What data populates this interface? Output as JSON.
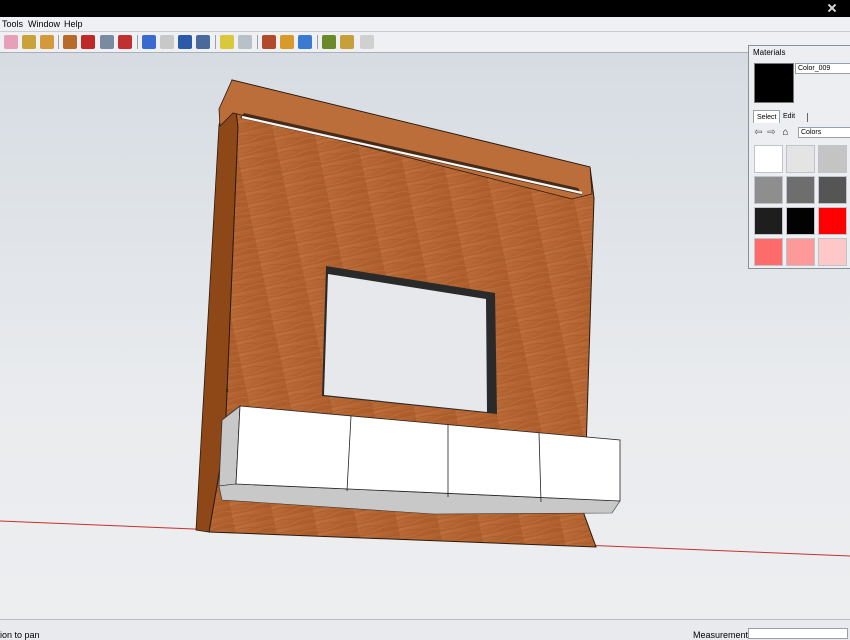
{
  "menu": [
    "Tools",
    "Window",
    "Help"
  ],
  "toolbar": {
    "icons": [
      {
        "name": "eraser-icon",
        "color": "#e8a0b8"
      },
      {
        "name": "tape-measure-icon",
        "color": "#c9a23a"
      },
      {
        "name": "paint-bucket-icon",
        "color": "#d49a3a"
      },
      {
        "name": "push-pull-icon",
        "color": "#b86a2a"
      },
      {
        "name": "move-icon",
        "color": "#c02828"
      },
      {
        "name": "rotate-icon",
        "color": "#7a8aa0"
      },
      {
        "name": "follow-me-icon",
        "color": "#c03030"
      },
      {
        "name": "orbit-icon",
        "color": "#3a6ad0"
      },
      {
        "name": "pan-icon",
        "color": "#c8c8c8"
      },
      {
        "name": "zoom-icon",
        "color": "#2a5aa8"
      },
      {
        "name": "zoom-extents-icon",
        "color": "#4a6a9a"
      },
      {
        "name": "add-location-icon",
        "color": "#d8c83a"
      },
      {
        "name": "toggle-terrain-icon",
        "color": "#b8c0c8"
      },
      {
        "name": "get-models-icon",
        "color": "#b04a2a"
      },
      {
        "name": "share-model-icon",
        "color": "#d89a2a"
      },
      {
        "name": "photo-textures-icon",
        "color": "#3a7ad0"
      },
      {
        "name": "extension-warehouse-icon",
        "color": "#6a8a2a"
      },
      {
        "name": "components-icon",
        "color": "#c8a03a"
      },
      {
        "name": "share-component-icon",
        "color": "#d0d0d0"
      }
    ]
  },
  "materials": {
    "title": "Materials",
    "current_color": "#000000",
    "current_name": "Color_009",
    "tabs": [
      "Select",
      "Edit"
    ],
    "library": "Colors",
    "swatches": [
      "#ffffff",
      "#e4e4e4",
      "#c4c4c4",
      "#8e8e8e",
      "#6e6e6e",
      "#555555",
      "#1e1e1e",
      "#020202",
      "#ff0000",
      "#fd6b6b",
      "#fd9999",
      "#ffc8c8"
    ]
  },
  "status": {
    "hint": "ion to pan",
    "measurements_label": "Measurements"
  },
  "model": {
    "wood_color": "#b86a38",
    "cabinet_color": "#ffffff",
    "axis_color": "#c83030"
  }
}
